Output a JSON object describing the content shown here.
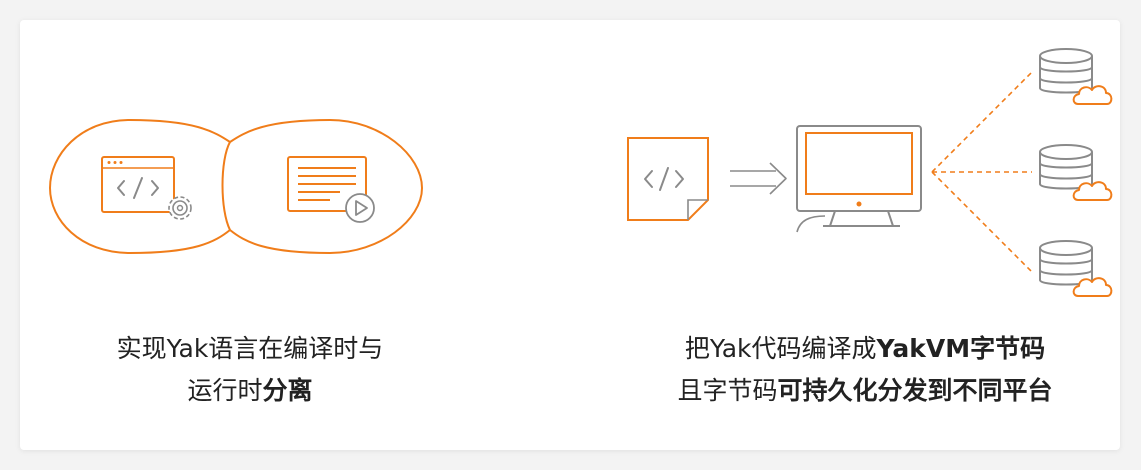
{
  "colors": {
    "accent": "#f07d1a",
    "gray": "#8a8a8a"
  },
  "left_caption": {
    "line1": "实现Yak语言在编译时与",
    "line2_plain": "运行时",
    "line2_bold": "分离"
  },
  "right_caption": {
    "line1_plain": "把Yak代码编译成",
    "line1_bold": "YakVM字节码",
    "line2_plain": "且字节码",
    "line2_bold": "可持久化分发到不同平台"
  },
  "icons": [
    "infinity-loop-icon",
    "code-window-icon",
    "gear-icon",
    "document-icon",
    "play-icon",
    "code-file-icon",
    "double-arrow-icon",
    "computer-monitor-icon",
    "database-icon",
    "cloud-icon"
  ]
}
